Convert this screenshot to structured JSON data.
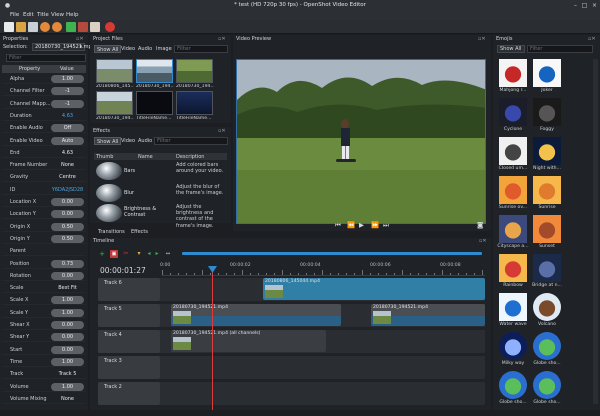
{
  "window": {
    "title": "* test (HD 720p 30 fps) - OpenShot Video Editor"
  },
  "menu": [
    "File",
    "Edit",
    "Title",
    "View",
    "Help"
  ],
  "properties": {
    "panel_title": "Properties",
    "selection_label": "Selection:",
    "selection_value": "20180730_194521.mp4",
    "filter_placeholder": "Filter",
    "col_property": "Property",
    "col_value": "Value",
    "rows": [
      {
        "name": "Alpha",
        "value": "1.00"
      },
      {
        "name": "Channel Filter",
        "value": "-1"
      },
      {
        "name": "Channel Mapp...",
        "value": "-1"
      },
      {
        "name": "Duration",
        "value": "4.63"
      },
      {
        "name": "Enable Audio",
        "value": "Off"
      },
      {
        "name": "Enable Video",
        "value": "Auto"
      },
      {
        "name": "End",
        "value": "4.63"
      },
      {
        "name": "Frame Number",
        "value": "None"
      },
      {
        "name": "Gravity",
        "value": "Centre"
      },
      {
        "name": "ID",
        "value": "Y6DA2JSD28"
      },
      {
        "name": "Location X",
        "value": "0.00"
      },
      {
        "name": "Location Y",
        "value": "0.00"
      },
      {
        "name": "Origin X",
        "value": "0.50"
      },
      {
        "name": "Origin Y",
        "value": "0.50"
      },
      {
        "name": "Parent",
        "value": ""
      },
      {
        "name": "Position",
        "value": "0.73"
      },
      {
        "name": "Rotation",
        "value": "0.00"
      },
      {
        "name": "Scale",
        "value": "Best Fit"
      },
      {
        "name": "Scale X",
        "value": "1.00"
      },
      {
        "name": "Scale Y",
        "value": "1.00"
      },
      {
        "name": "Shear X",
        "value": "0.00"
      },
      {
        "name": "Shear Y",
        "value": "0.00"
      },
      {
        "name": "Start",
        "value": "0.00"
      },
      {
        "name": "Time",
        "value": "1.00"
      },
      {
        "name": "Track",
        "value": "Track 5"
      },
      {
        "name": "Volume",
        "value": "1.00"
      },
      {
        "name": "Volume Mixing",
        "value": "None"
      }
    ]
  },
  "project_files": {
    "panel_title": "Project Files",
    "tabs": [
      "Show All",
      "Video",
      "Audio",
      "Image"
    ],
    "filter_placeholder": "Filter",
    "items": [
      "20180806_145...",
      "20180730_194...",
      "20180730_194...",
      "20180730_194...",
      "TitleFileName...",
      "TitleFileName..."
    ]
  },
  "effects": {
    "panel_title": "Effects",
    "tabs": [
      "Show All",
      "Video",
      "Audio"
    ],
    "filter_placeholder": "Filter",
    "col_thumb": "Thumb",
    "col_name": "Name",
    "col_desc": "Description",
    "rows": [
      {
        "name": "Bars",
        "desc": "Add colored bars around your video."
      },
      {
        "name": "Blur",
        "desc": "Adjust the blur of the frame's image."
      },
      {
        "name": "Brightness & Contrast",
        "desc": "Adjust the brightness and contrast of the frame's image."
      }
    ]
  },
  "preview": {
    "panel_title": "Video Preview"
  },
  "emojis": {
    "panel_title": "Emojis",
    "show_all": "Show All",
    "filter_placeholder": "Filter",
    "items": [
      "Mahjong r...",
      "Joker",
      "Cyclone",
      "Foggy",
      "Closed um...",
      "Night with...",
      "Sunrise ov...",
      "Sunrise",
      "Cityscape a...",
      "Sunset",
      "Rainbow",
      "Bridge at n...",
      "Water wave",
      "Volcano",
      "Milky way",
      "Globe sho...",
      "Globe sho...",
      "Globe sho..."
    ]
  },
  "bottom_tabs": [
    "Transitions",
    "Effects"
  ],
  "timeline": {
    "panel_title": "Timeline",
    "timecode": "00:00:01:27",
    "ruler": [
      "0:00",
      "00:00:02",
      "00:00:04",
      "00:00:06",
      "00:00:08"
    ],
    "tracks": [
      {
        "label": "Track 6",
        "clips": [
          {
            "title": "20180806_145044.mp4"
          }
        ]
      },
      {
        "label": "Track 5",
        "clips": [
          {
            "title": "20180730_194521.mp4"
          },
          {
            "title": "20180730_194521.mp4"
          }
        ]
      },
      {
        "label": "Track 4",
        "clips": [
          {
            "title": "20180730_194521.mp4 (all channels)"
          }
        ]
      },
      {
        "label": "Track 3",
        "clips": []
      },
      {
        "label": "Track 2",
        "clips": []
      }
    ]
  },
  "colors": {
    "accent": "#2e8bd0",
    "playhead": "#e03b3b",
    "background": "#1c1e22"
  }
}
